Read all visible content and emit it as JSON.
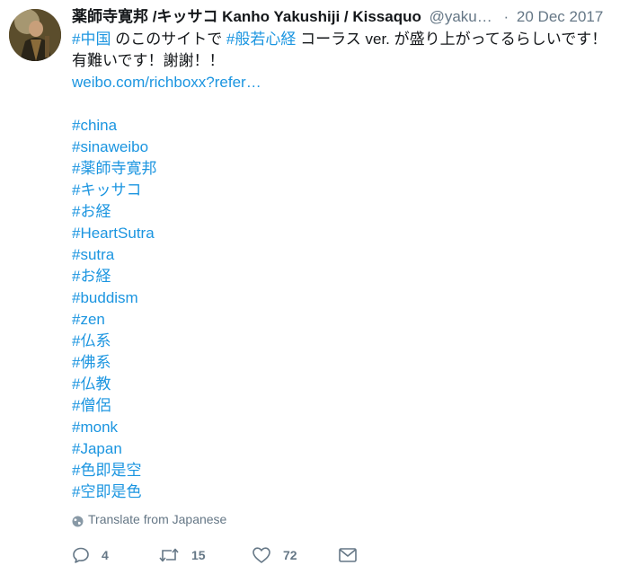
{
  "tweet": {
    "author_name": "薬師寺寛邦 /キッサコ Kanho Yakushiji / Kissaquo",
    "handle": "@yaku…",
    "separator": "·",
    "date": "20 Dec 2017",
    "line1": [
      {
        "text": "#中国",
        "link": true
      },
      {
        "text": " のこのサイトで ",
        "link": false
      },
      {
        "text": "#般若心経",
        "link": true
      },
      {
        "text": " コーラス ver. が盛り上がってるらしいです！",
        "link": false
      }
    ],
    "line2": "有難いです！謝謝！！",
    "url": "weibo.com/richboxx?refer…",
    "hashtags": [
      "#china",
      "#sinaweibo",
      "#薬師寺寛邦",
      "#キッサコ",
      "#お経",
      "#HeartSutra",
      "#sutra",
      "#お経",
      "#buddism",
      "#zen",
      "#仏系",
      "#佛系",
      "#仏教",
      "#僧侶",
      "#monk",
      "#Japan",
      "#色即是空",
      "#空即是色"
    ],
    "translate_label": "Translate from Japanese",
    "reply_count": "4",
    "retweet_count": "15",
    "like_count": "72"
  },
  "icons": {
    "globe": "globe-icon",
    "reply": "reply-icon",
    "retweet": "retweet-icon",
    "like": "heart-icon",
    "dm": "envelope-icon"
  },
  "colors": {
    "link": "#1b95e0",
    "text": "#14171a",
    "muted": "#657786"
  }
}
